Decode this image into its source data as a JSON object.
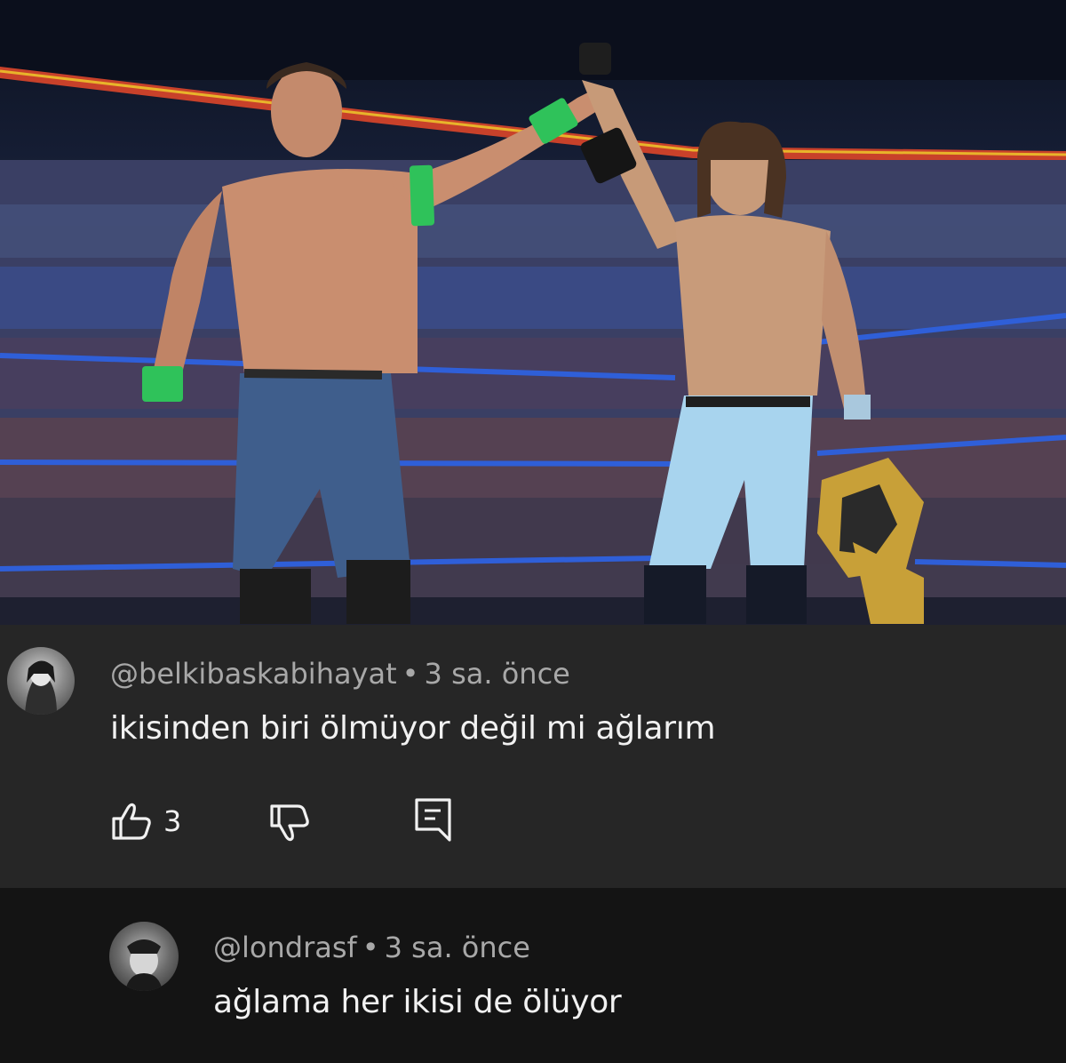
{
  "photo": {
    "alt": ""
  },
  "comments": [
    {
      "handle": "@belkibaskabihayat",
      "time": "3 sa. önce",
      "text": "ikisinden biri ölmüyor değil mi ağlarım",
      "likes": "3",
      "icons": {
        "like": "thumbs-up-icon",
        "dislike": "thumbs-down-icon",
        "reply": "reply-icon"
      }
    },
    {
      "handle": "@londrasf",
      "time": "3 sa. önce",
      "text": "ağlama her ikisi de ölüyor"
    }
  ],
  "colors": {
    "card": "#262626",
    "page": "#141414",
    "text": "#f1f1f1",
    "meta": "#a8a8a8"
  }
}
